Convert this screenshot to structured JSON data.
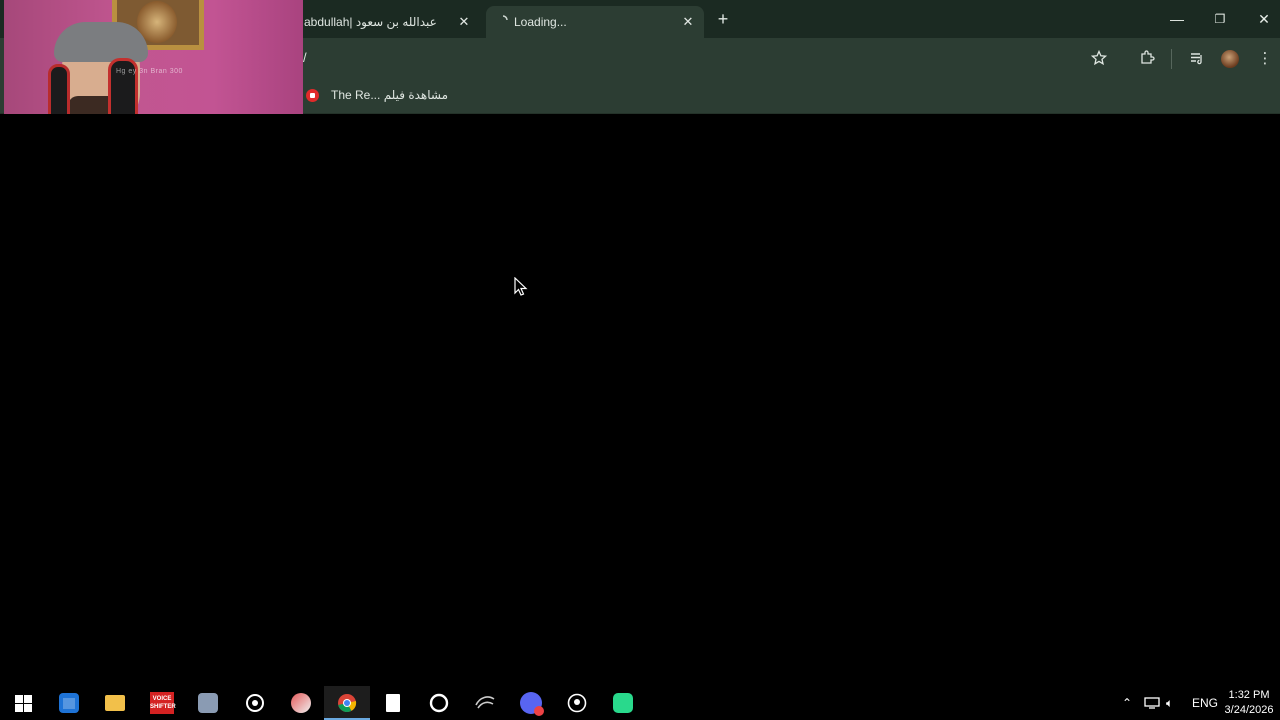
{
  "browser": {
    "tabs": [
      {
        "label": "abdullah| عبدالله بن سعود",
        "state": "inactive"
      },
      {
        "label": "Loading...",
        "state": "active"
      }
    ],
    "new_tab_label": "+",
    "omnibox_text": "/",
    "bookmarks": [
      {
        "label": "The Re... مشاهدة فيلم",
        "icon": "youtube-icon"
      }
    ]
  },
  "window_controls": {
    "minimize": "—",
    "restore": "❐",
    "close": "✕"
  },
  "webcam": {
    "watermark": "Hg ey 3n Bran 300"
  },
  "taskbar": {
    "apps": [
      {
        "name": "start",
        "icon": "windows-icon"
      },
      {
        "name": "store",
        "icon": "store-icon"
      },
      {
        "name": "explorer",
        "icon": "folder-icon"
      },
      {
        "name": "voicemod",
        "icon": "voice-shifter-icon",
        "label": "VOICE\nSHIFTER"
      },
      {
        "name": "app5",
        "icon": "app-icon"
      },
      {
        "name": "steam",
        "icon": "steam-icon"
      },
      {
        "name": "app7",
        "icon": "app-icon"
      },
      {
        "name": "chrome",
        "icon": "chrome-icon"
      },
      {
        "name": "file",
        "icon": "file-icon"
      },
      {
        "name": "cortana",
        "icon": "circle-icon"
      },
      {
        "name": "app11",
        "icon": "app-icon"
      },
      {
        "name": "discord",
        "icon": "discord-icon"
      },
      {
        "name": "app13",
        "icon": "app-icon"
      },
      {
        "name": "app14",
        "icon": "app-icon"
      }
    ],
    "tray": {
      "language": "ENG",
      "time": "1:32 PM",
      "date": "3/24/2026"
    }
  },
  "colors": {
    "tabbar_bg": "#1b2a22",
    "toolbar_bg": "#2c3d33",
    "page_bg": "#000000"
  }
}
